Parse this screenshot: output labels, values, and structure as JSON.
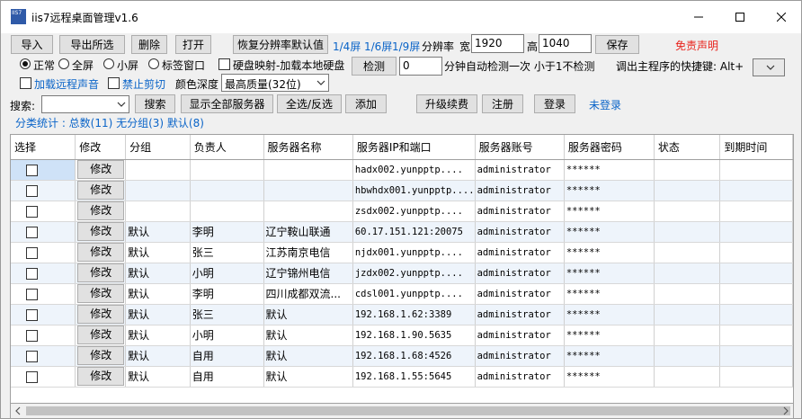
{
  "window": {
    "title": "iis7远程桌面管理v1.6",
    "icon_text": "IIS7"
  },
  "toolbar": {
    "import": "导入",
    "export_selected": "导出所选",
    "delete": "删除",
    "open": "打开",
    "restore_resolution": "恢复分辨率默认值",
    "screen_quarter": "1/4屏",
    "screen_sixth": "1/6屏",
    "screen_ninth": "1/9屏",
    "resolution_label": "分辨率",
    "width_label": "宽",
    "width_value": "1920",
    "height_label": "高",
    "height_value": "1040",
    "save": "保存",
    "disclaimer": "免责声明"
  },
  "mode": {
    "normal": "正常",
    "fullscreen": "全屏",
    "small": "小屏",
    "tab_window": "标签窗口",
    "disk_mapping": "硬盘映射-加载本地硬盘",
    "detect": "检测",
    "interval_value": "0",
    "auto_detect_text": "分钟自动检测一次 小于1不检测",
    "hotkey_label": "调出主程序的快捷键: Alt+"
  },
  "options": {
    "remote_sound": "加载远程声音",
    "disable_clipboard": "禁止剪切",
    "color_depth_label": "颜色深度",
    "color_depth_value": "最高质量(32位)"
  },
  "search": {
    "label": "搜索:",
    "search_button": "搜索",
    "show_all": "显示全部服务器",
    "select_all": "全选/反选",
    "add": "添加",
    "upgrade": "升级续费",
    "register": "注册",
    "login": "登录",
    "not_logged_in": "未登录"
  },
  "stats": {
    "text": "分类统计 : 总数(11) 无分组(3) 默认(8)"
  },
  "table": {
    "columns": [
      "选择",
      "修改",
      "分组",
      "负责人",
      "服务器名称",
      "服务器IP和端口",
      "服务器账号",
      "服务器密码",
      "状态",
      "到期时间"
    ],
    "edit_label": "修改",
    "rows": [
      {
        "group": "",
        "owner": "",
        "name": "",
        "ip": "hadx002.yunpptp....",
        "account": "administrator",
        "password": "******",
        "status": "",
        "expiry": ""
      },
      {
        "group": "",
        "owner": "",
        "name": "",
        "ip": "hbwhdx001.yunpptp....",
        "account": "administrator",
        "password": "******",
        "status": "",
        "expiry": ""
      },
      {
        "group": "",
        "owner": "",
        "name": "",
        "ip": "zsdx002.yunpptp....",
        "account": "administrator",
        "password": "******",
        "status": "",
        "expiry": ""
      },
      {
        "group": "默认",
        "owner": "李明",
        "name": "辽宁鞍山联通",
        "ip": "60.17.151.121:20075",
        "account": "administrator",
        "password": "******",
        "status": "",
        "expiry": ""
      },
      {
        "group": "默认",
        "owner": "张三",
        "name": "江苏南京电信",
        "ip": "njdx001.yunpptp....",
        "account": "administrator",
        "password": "******",
        "status": "",
        "expiry": ""
      },
      {
        "group": "默认",
        "owner": "小明",
        "name": "辽宁锦州电信",
        "ip": "jzdx002.yunpptp....",
        "account": "administrator",
        "password": "******",
        "status": "",
        "expiry": ""
      },
      {
        "group": "默认",
        "owner": "李明",
        "name": "四川成都双流...",
        "ip": "cdsl001.yunpptp....",
        "account": "administrator",
        "password": "******",
        "status": "",
        "expiry": ""
      },
      {
        "group": "默认",
        "owner": "张三",
        "name": "默认",
        "ip": "192.168.1.62:3389",
        "account": "administrator",
        "password": "******",
        "status": "",
        "expiry": ""
      },
      {
        "group": "默认",
        "owner": "小明",
        "name": "默认",
        "ip": "192.168.1.90.5635",
        "account": "administrator",
        "password": "******",
        "status": "",
        "expiry": ""
      },
      {
        "group": "默认",
        "owner": "自用",
        "name": "默认",
        "ip": "192.168.1.68:4526",
        "account": "administrator",
        "password": "******",
        "status": "",
        "expiry": ""
      },
      {
        "group": "默认",
        "owner": "自用",
        "name": "默认",
        "ip": "192.168.1.55:5645",
        "account": "administrator",
        "password": "******",
        "status": "",
        "expiry": ""
      }
    ]
  }
}
